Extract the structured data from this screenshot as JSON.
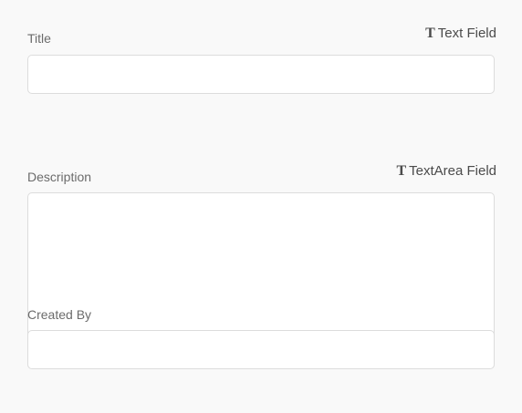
{
  "fields": {
    "title": {
      "label": "Title",
      "type_label": "Text Field",
      "type_icon": "T",
      "value": ""
    },
    "description": {
      "label": "Description",
      "type_label": "TextArea Field",
      "type_icon": "T",
      "value": ""
    },
    "created_by": {
      "label": "Created By",
      "value": ""
    }
  }
}
